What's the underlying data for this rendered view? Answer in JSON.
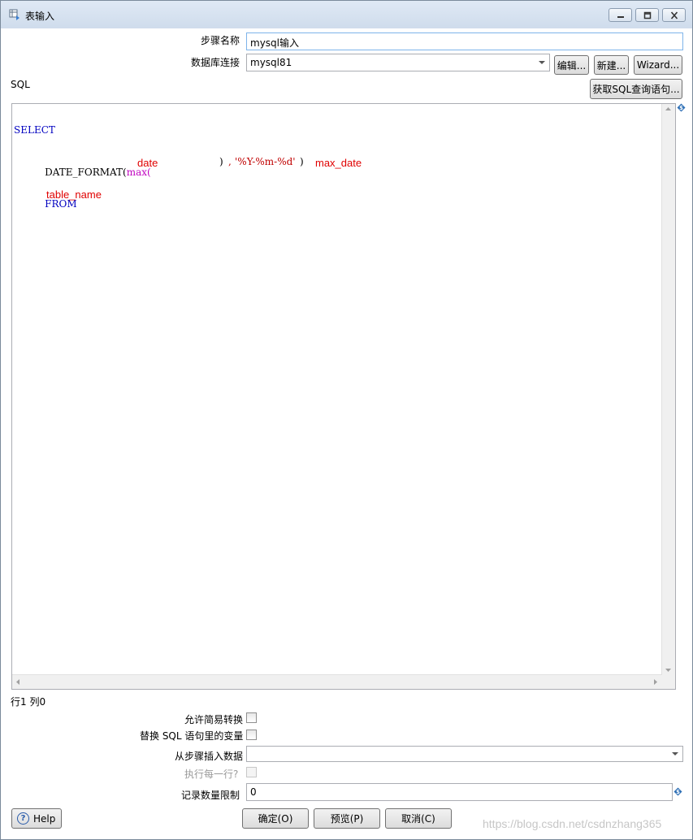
{
  "window": {
    "title": "表输入",
    "minimize_icon": "minimize-icon",
    "maximize_icon": "restore-icon",
    "close_icon": "close-icon"
  },
  "form": {
    "step_name_label": "步骤名称",
    "step_name_value": "mysql输入",
    "db_conn_label": "数据库连接",
    "db_conn_value": "mysql81",
    "edit_button": "编辑...",
    "new_button": "新建...",
    "wizard_button": "Wizard...",
    "sql_label": "SQL",
    "get_sql_button": "获取SQL查询语句..."
  },
  "sql": {
    "line1": "SELECT",
    "line2_fn_prefix": "DATE_FORMAT(",
    "line2_max": "max",
    "line2_paren": "(",
    "line2_placeholder_date": "date",
    "line2_close": ")",
    "line2_comma": ",",
    "line2_format": "'%Y-%m-%d'",
    "line2_end": ")",
    "line2_alias": "max_date",
    "line3_from": "FROM",
    "line3_table": "table_name"
  },
  "status": {
    "cursor_position": "行1 列0"
  },
  "options": {
    "lazy_conversion_label": "允许简易转换",
    "replace_variables_label": "替换 SQL 语句里的变量",
    "insert_from_step_label": "从步骤插入数据",
    "insert_from_step_value": "",
    "execute_each_row_label": "执行每一行?",
    "limit_label": "记录数量限制",
    "limit_value": "0"
  },
  "buttons": {
    "help": "Help",
    "ok": "确定(O)",
    "preview": "预览(P)",
    "cancel": "取消(C)"
  },
  "watermark": "https://blog.csdn.net/csdnzhang365",
  "colors": {
    "keyword": "#0000c0",
    "function": "#c000c0",
    "string": "#c00000",
    "placeholder": "#e00000"
  }
}
